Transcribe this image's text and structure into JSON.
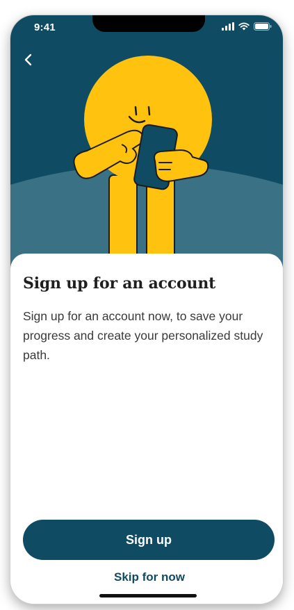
{
  "status_bar": {
    "time": "9:41",
    "icons": [
      "cellular-signal-icon",
      "wifi-icon",
      "battery-icon"
    ]
  },
  "navigation": {
    "back_icon": "chevron-left-icon"
  },
  "hero": {
    "illustration": "character-pointing-at-phone",
    "colors": {
      "background": "#0f4c63",
      "hill": "#3b7185",
      "character": "#ffc20e",
      "phone": "#0f4c63"
    }
  },
  "content": {
    "title": "Sign up for an account",
    "body": "Sign up for an account now, to save your progress and create your personalized study path."
  },
  "actions": {
    "primary_label": "Sign up",
    "secondary_label": "Skip for now"
  },
  "theme": {
    "accent": "#0f4c63",
    "text": "#1f1f1f",
    "body_text": "#3a3a3a"
  }
}
